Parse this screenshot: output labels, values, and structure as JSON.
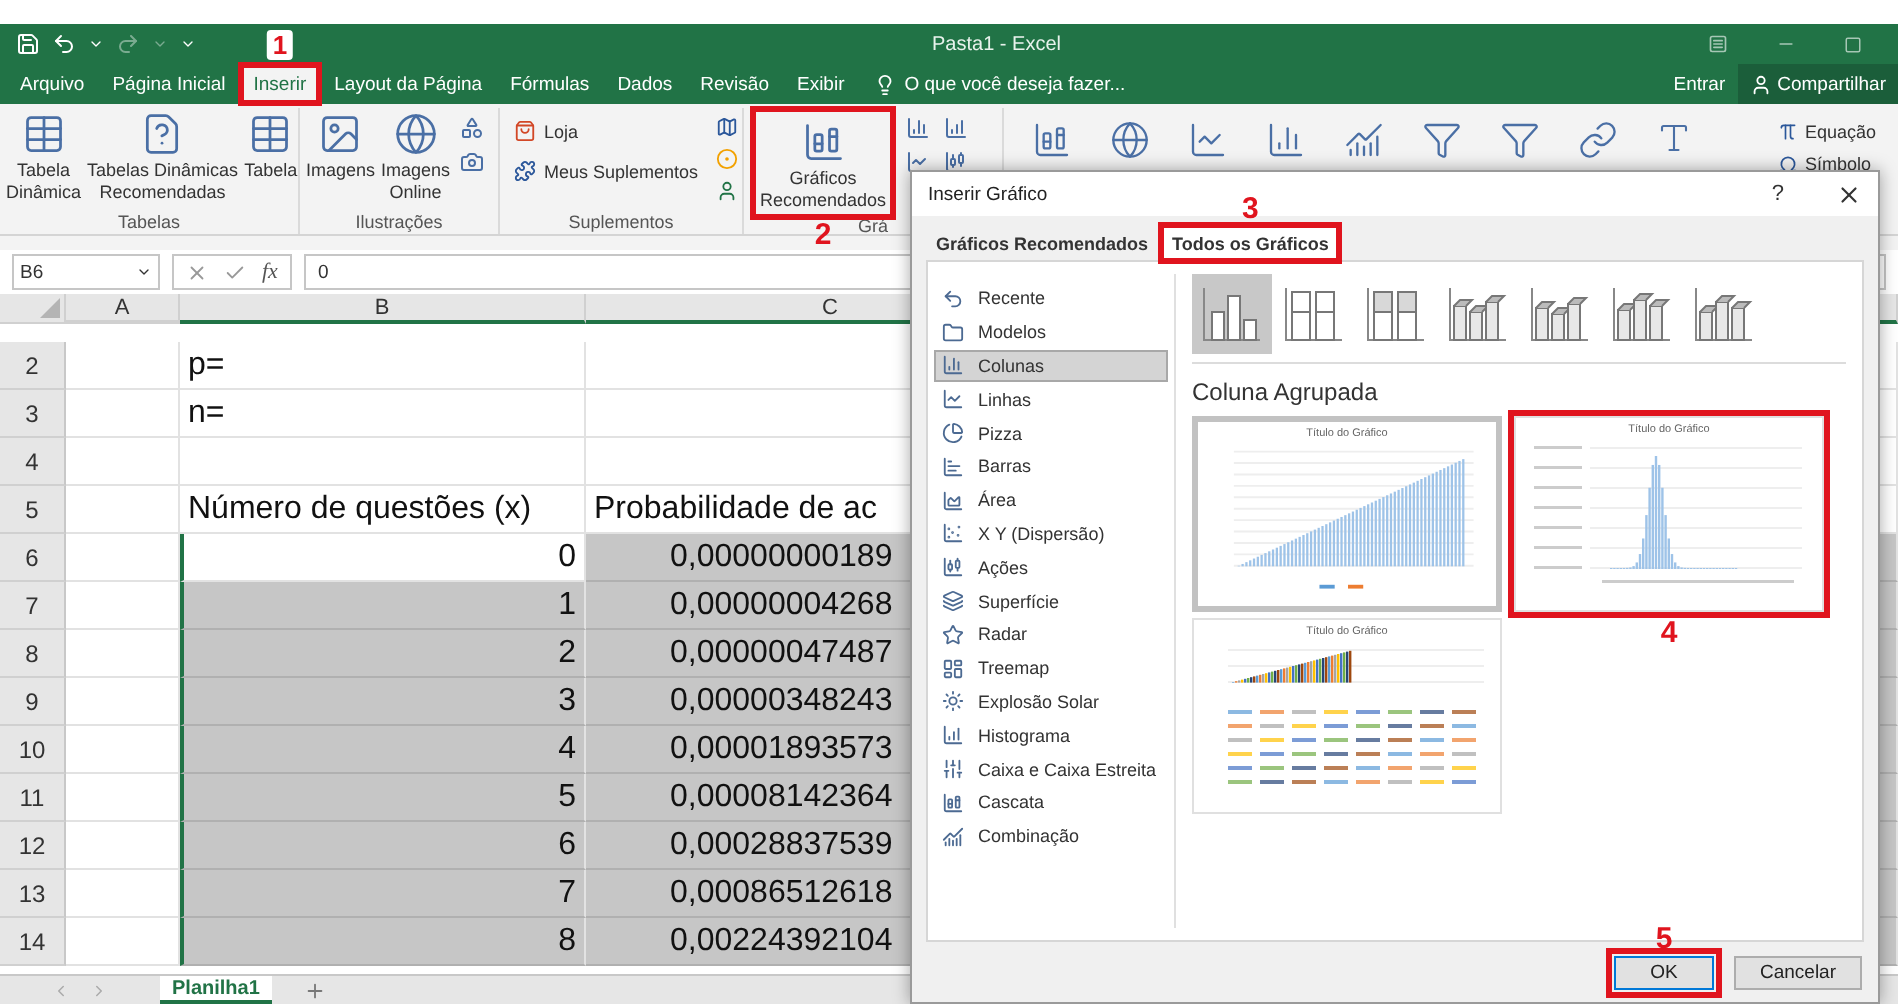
{
  "window": {
    "title": "Pasta1 - Excel"
  },
  "menu_tabs": [
    {
      "label": "Arquivo",
      "selected": false
    },
    {
      "label": "Página Inicial",
      "selected": false
    },
    {
      "label": "Inserir",
      "selected": true,
      "marker": {
        "label": "1"
      }
    },
    {
      "label": "Layout da Página",
      "selected": false
    },
    {
      "label": "Fórmulas",
      "selected": false
    },
    {
      "label": "Dados",
      "selected": false
    },
    {
      "label": "Revisão",
      "selected": false
    },
    {
      "label": "Exibir",
      "selected": false
    }
  ],
  "search": {
    "placeholder": "O que você deseja fazer..."
  },
  "account": {
    "sign_in": "Entrar",
    "share": "Compartilhar"
  },
  "ribbon": {
    "groups": [
      {
        "label": "Tabelas",
        "buttons": [
          {
            "kind": "large",
            "lines": [
              "Tabela",
              "Dinâmica"
            ]
          },
          {
            "kind": "large",
            "lines": [
              "Tabelas Dinâmicas",
              "Recomendadas"
            ]
          },
          {
            "kind": "large",
            "lines": [
              "Tabela"
            ]
          }
        ]
      },
      {
        "label": "Ilustrações",
        "buttons": [
          {
            "kind": "large",
            "lines": [
              "Imagens"
            ]
          },
          {
            "kind": "large",
            "lines": [
              "Imagens",
              "Online"
            ]
          }
        ]
      },
      {
        "label": "Suplementos",
        "buttons": [
          {
            "kind": "small",
            "lines": [
              "Loja"
            ]
          },
          {
            "kind": "small",
            "lines": [
              "Meus Suplementos"
            ]
          }
        ]
      },
      {
        "label": "Grá",
        "buttons": [
          {
            "kind": "large",
            "lines": [
              "Gráficos",
              "Recomendados"
            ],
            "marker": {
              "label": "2"
            }
          }
        ]
      }
    ],
    "symbols": [
      {
        "label": "Equação"
      },
      {
        "label": "Símbolo"
      }
    ]
  },
  "formula_bar": {
    "name_box": "B6",
    "function_label": "fx",
    "value": "0"
  },
  "sheet": {
    "columns": [
      {
        "label": "A",
        "selected": false
      },
      {
        "label": "B",
        "selected": true
      },
      {
        "label": "C",
        "selected": true
      }
    ],
    "rows": [
      {
        "header": "2",
        "cells": [
          {
            "selected": false
          },
          {
            "text": "p=",
            "kind": "text",
            "selected": false
          },
          {
            "selected": false
          }
        ]
      },
      {
        "header": "3",
        "cells": [
          {
            "selected": false
          },
          {
            "text": "n=",
            "kind": "text",
            "selected": false
          },
          {
            "selected": false
          }
        ]
      },
      {
        "header": "4",
        "cells": [
          {
            "selected": false
          },
          {
            "selected": false
          },
          {
            "selected": false
          }
        ]
      },
      {
        "header": "5",
        "cells": [
          {
            "selected": false
          },
          {
            "text": "Número de questões (x)",
            "kind": "text",
            "selected": false
          },
          {
            "text": "Probabilidade de ac",
            "kind": "text",
            "selected": false
          }
        ]
      },
      {
        "header": "6",
        "cells": [
          {
            "selected": false
          },
          {
            "text": "0",
            "kind": "number",
            "selected": false
          },
          {
            "text": "0,00000000189",
            "kind": "number",
            "selected": true
          }
        ]
      },
      {
        "header": "7",
        "cells": [
          {
            "selected": false
          },
          {
            "text": "1",
            "kind": "number",
            "selected": true
          },
          {
            "text": "0,00000004268",
            "kind": "number",
            "selected": true
          }
        ]
      },
      {
        "header": "8",
        "cells": [
          {
            "selected": false
          },
          {
            "text": "2",
            "kind": "number",
            "selected": true
          },
          {
            "text": "0,00000047487",
            "kind": "number",
            "selected": true
          }
        ]
      },
      {
        "header": "9",
        "cells": [
          {
            "selected": false
          },
          {
            "text": "3",
            "kind": "number",
            "selected": true
          },
          {
            "text": "0,00000348243",
            "kind": "number",
            "selected": true
          }
        ]
      },
      {
        "header": "10",
        "cells": [
          {
            "selected": false
          },
          {
            "text": "4",
            "kind": "number",
            "selected": true
          },
          {
            "text": "0,00001893573",
            "kind": "number",
            "selected": true
          }
        ]
      },
      {
        "header": "11",
        "cells": [
          {
            "selected": false
          },
          {
            "text": "5",
            "kind": "number",
            "selected": true
          },
          {
            "text": "0,00008142364",
            "kind": "number",
            "selected": true
          }
        ]
      },
      {
        "header": "12",
        "cells": [
          {
            "selected": false
          },
          {
            "text": "6",
            "kind": "number",
            "selected": true
          },
          {
            "text": "0,00028837539",
            "kind": "number",
            "selected": true
          }
        ]
      },
      {
        "header": "13",
        "cells": [
          {
            "selected": false
          },
          {
            "text": "7",
            "kind": "number",
            "selected": true
          },
          {
            "text": "0,00086512618",
            "kind": "number",
            "selected": true
          }
        ]
      },
      {
        "header": "14",
        "cells": [
          {
            "selected": false
          },
          {
            "text": "8",
            "kind": "number",
            "selected": true
          },
          {
            "text": "0,00224392104",
            "kind": "number",
            "selected": true
          }
        ]
      }
    ]
  },
  "sheet_tabs": [
    {
      "label": "Planilha1",
      "selected": true
    }
  ],
  "dialog": {
    "title": "Inserir Gráfico",
    "help": "?",
    "tabs": [
      {
        "label": "Gráficos Recomendados",
        "selected": false
      },
      {
        "label": "Todos os Gráficos",
        "selected": true,
        "marker": {
          "label": "3"
        }
      }
    ],
    "chart_types": [
      {
        "label": "Recente",
        "selected": false
      },
      {
        "label": "Modelos",
        "selected": false
      },
      {
        "label": "Colunas",
        "selected": true
      },
      {
        "label": "Linhas",
        "selected": false
      },
      {
        "label": "Pizza",
        "selected": false
      },
      {
        "label": "Barras",
        "selected": false
      },
      {
        "label": "Área",
        "selected": false
      },
      {
        "label": "X Y (Dispersão)",
        "selected": false
      },
      {
        "label": "Ações",
        "selected": false
      },
      {
        "label": "Superfície",
        "selected": false
      },
      {
        "label": "Radar",
        "selected": false
      },
      {
        "label": "Treemap",
        "selected": false
      },
      {
        "label": "Explosão Solar",
        "selected": false
      },
      {
        "label": "Histograma",
        "selected": false
      },
      {
        "label": "Caixa e Caixa Estreita",
        "selected": false
      },
      {
        "label": "Cascata",
        "selected": false
      },
      {
        "label": "Combinação",
        "selected": false
      }
    ],
    "subtypes": [
      {
        "selected": true
      },
      {
        "selected": false
      },
      {
        "selected": false
      },
      {
        "selected": false
      },
      {
        "selected": false
      },
      {
        "selected": false
      },
      {
        "selected": false
      }
    ],
    "subtype_title": "Coluna Agrupada",
    "previews": [
      {
        "title": "Título do Gráfico",
        "kind": "rising",
        "selected": true
      },
      {
        "title": "Título do Gráfico",
        "kind": "bell",
        "selected": false,
        "marker": {
          "label": "4"
        }
      },
      {
        "title": "Título do Gráfico",
        "kind": "clustered",
        "selected": false
      }
    ],
    "buttons": [
      {
        "label": "OK",
        "kind": "primary",
        "marker": {
          "label": "5"
        }
      },
      {
        "label": "Cancelar",
        "kind": "secondary"
      }
    ]
  }
}
